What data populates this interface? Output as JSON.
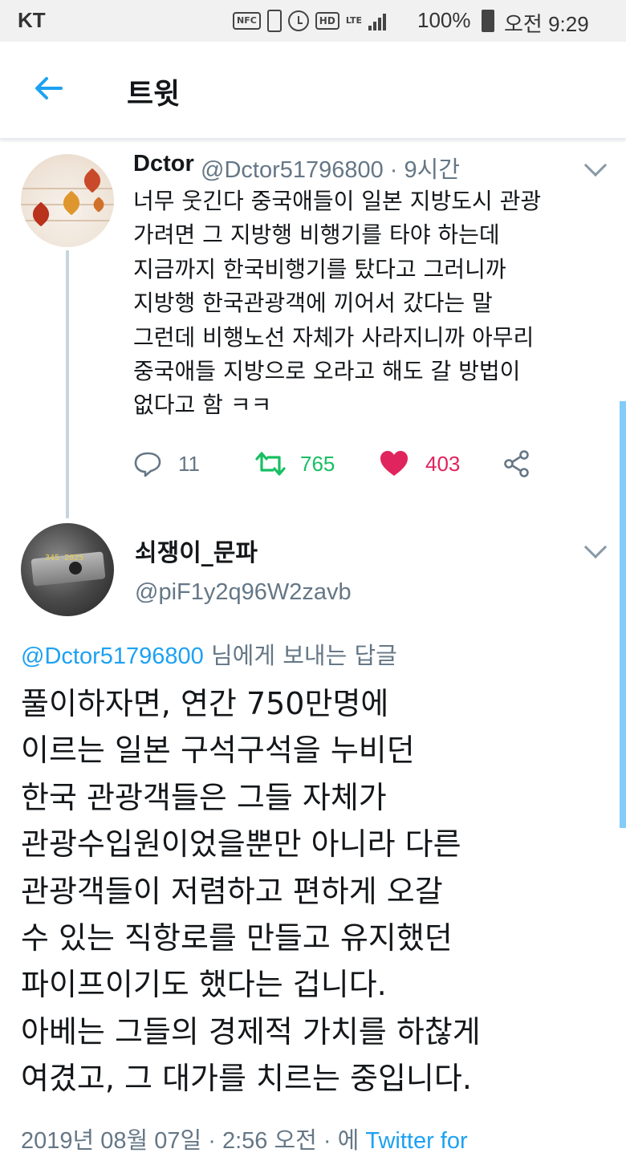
{
  "status_bar": {
    "carrier": "KT",
    "nfc": "NFC",
    "hd": "HD",
    "network": "LTE",
    "battery": "100%",
    "time": "오전 9:29"
  },
  "header": {
    "title": "트윗"
  },
  "tweet": {
    "name": "Dctor",
    "meta": "@Dctor51796800 · 9시간",
    "lines": [
      "너무 웃긴다 중국애들이 일본 지방도시 관광",
      "가려면 그 지방행 비행기를 타야 하는데",
      "지금까지 한국비행기를 탔다고 그러니까",
      "지방행 한국관광객에 끼어서 갔다는 말",
      "그런데 비행노선 자체가 사라지니까 아무리",
      "중국애들 지방으로 오라고 해도 갈 방법이",
      "없다고 함 ㅋㅋ"
    ],
    "replies": "11",
    "retweets": "765",
    "likes": "403"
  },
  "reply": {
    "name": "쇠쟁이_문파",
    "handle": "@piF1y2q96W2zavb",
    "reply_to_mention": "@Dctor51796800",
    "reply_to_suffix": " 님에게 보내는 답글",
    "lines": [
      "풀이하자면, 연간 750만명에",
      "이르는 일본 구석구석을 누비던",
      "한국 관광객들은 그들 자체가",
      "관광수입원이었을뿐만 아니라 다른",
      "관광객들이 저렴하고 편하게 오갈",
      "수 있는 직항로를 만들고 유지했던",
      "파이프이기도 했다는 겁니다.",
      "아베는 그들의 경제적 가치를 하찮게",
      "여겼고, 그 대가를 치르는 중입니다."
    ],
    "timestamp": "2019년 08월 07일 · 2:56 오전 · 에 ",
    "source": "Twitter for"
  },
  "colors": {
    "accent": "#1da1f2",
    "retweet": "#17bf63",
    "like": "#e0245e",
    "muted": "#657786"
  }
}
